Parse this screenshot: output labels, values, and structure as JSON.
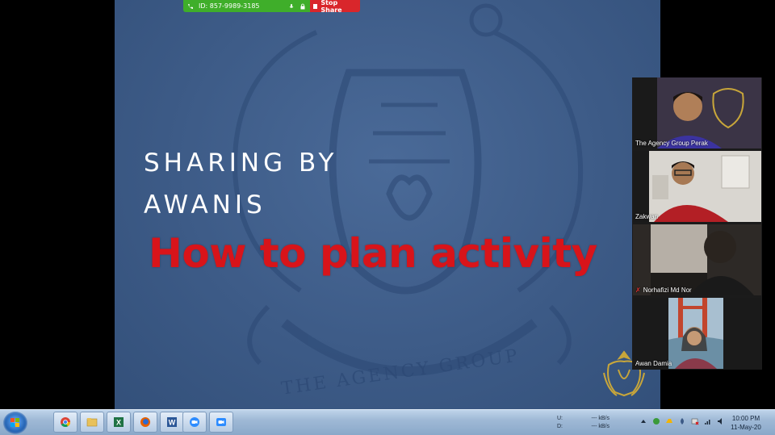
{
  "share_bar": {
    "meeting_id": "ID: 857-9989-3185",
    "stop_share_label": "Stop Share",
    "colors": {
      "sharing": "#3fae2a",
      "stop": "#d9262b"
    }
  },
  "slide": {
    "title_line1": "SHARING BY",
    "title_line2": "AWANIS",
    "subtitle": "How to plan activity",
    "watermark_text": "THE AGENCY GROUP",
    "colors": {
      "background": "#3d5b87",
      "subtitle": "#d8141a",
      "title": "#ffffff"
    }
  },
  "participants": [
    {
      "name": "The Agency Group Perak",
      "muted": false,
      "active": false,
      "icon": "person-video"
    },
    {
      "name": "Zakwan",
      "muted": false,
      "active": false,
      "icon": "person-video"
    },
    {
      "name": "Norhafizi Md Nor",
      "muted": true,
      "active": false,
      "icon": "person-video"
    },
    {
      "name": "Awan Damia",
      "muted": false,
      "active": true,
      "icon": "person-video"
    }
  ],
  "taskbar": {
    "apps": [
      "chrome-icon",
      "file-explorer-icon",
      "excel-icon",
      "firefox-icon",
      "word-icon",
      "zoom-icon",
      "zoom-meeting-icon"
    ],
    "net_meter": {
      "upload_label": "U:",
      "upload_value": "--- kB/s",
      "download_label": "D:",
      "download_value": "--- kB/s"
    },
    "clock": {
      "time": "10:00 PM",
      "date": "11-May-20"
    }
  }
}
